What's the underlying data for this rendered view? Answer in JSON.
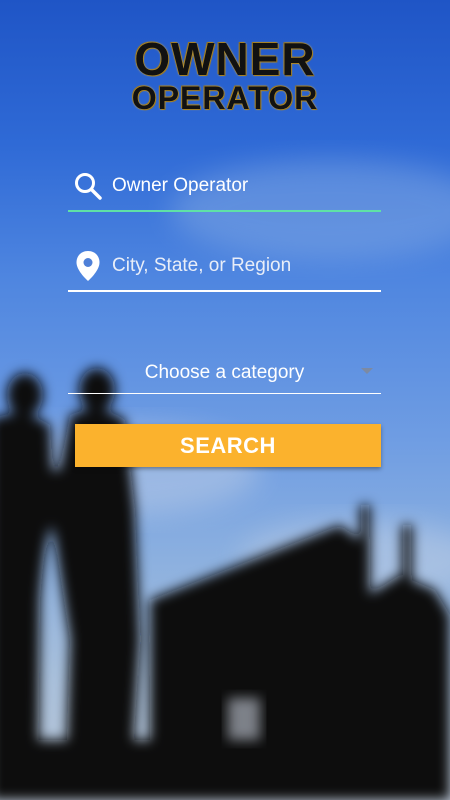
{
  "logo": {
    "line1": "OWNER",
    "line2": "OPERATOR"
  },
  "search_field": {
    "value": "Owner Operator",
    "icon": "search-icon"
  },
  "location_field": {
    "placeholder": "City, State, or Region",
    "icon": "location-pin-icon"
  },
  "category_select": {
    "selected": "Choose a category",
    "icon": "chevron-down-icon"
  },
  "search_button": {
    "label": "SEARCH"
  },
  "colors": {
    "accent": "#fbb22d",
    "active_underline": "#5fe1a6"
  }
}
